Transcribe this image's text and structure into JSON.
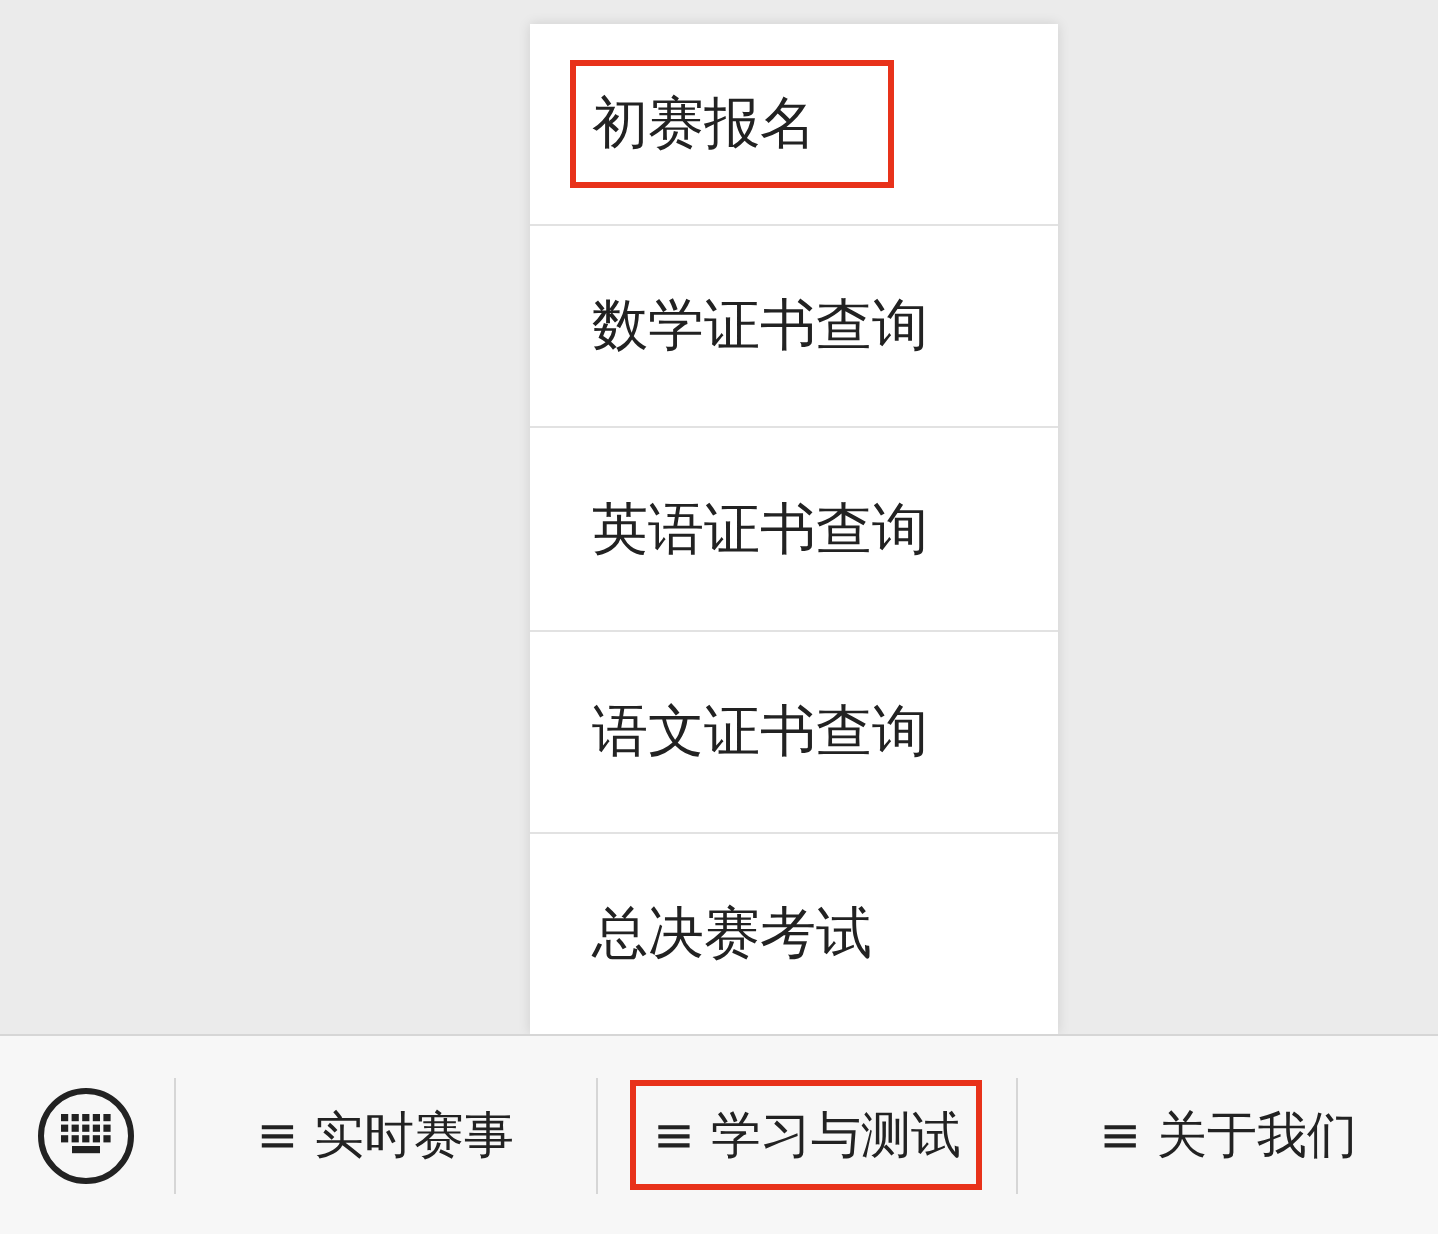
{
  "menu": {
    "items": [
      {
        "label": "初赛报名",
        "highlighted": true
      },
      {
        "label": "数学证书查询",
        "highlighted": false
      },
      {
        "label": "英语证书查询",
        "highlighted": false
      },
      {
        "label": "语文证书查询",
        "highlighted": false
      },
      {
        "label": "总决赛考试",
        "highlighted": false
      }
    ]
  },
  "bottom_bar": {
    "tabs": [
      {
        "label": "≡ 实时赛事",
        "highlighted": false
      },
      {
        "label": "≡ 学习与测试",
        "highlighted": true
      },
      {
        "label": "≡ 关于我们",
        "highlighted": false
      }
    ]
  }
}
